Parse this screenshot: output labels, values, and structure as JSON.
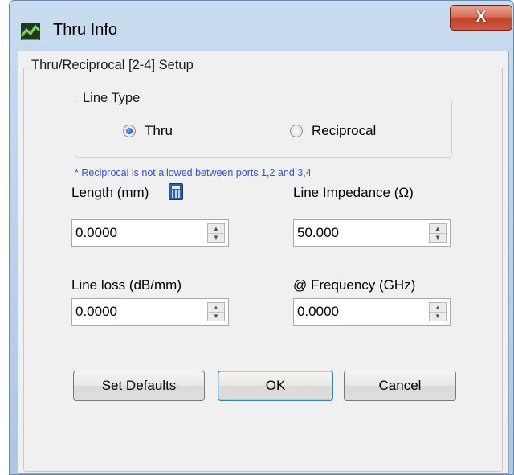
{
  "window": {
    "title": "Thru Info",
    "close_label": "X"
  },
  "setup_group": {
    "title": "Thru/Reciprocal [2-4] Setup"
  },
  "line_type": {
    "title": "Line Type",
    "options": [
      {
        "label": "Thru",
        "checked": true
      },
      {
        "label": "Reciprocal",
        "checked": false
      }
    ]
  },
  "note": "* Reciprocal is not allowed between ports 1,2 and 3,4",
  "fields": {
    "length": {
      "label": "Length (mm)",
      "value": "0.0000"
    },
    "line_impedance": {
      "label": "Line Impedance (Ω)",
      "value": "50.000"
    },
    "line_loss": {
      "label": "Line loss (dB/mm)",
      "value": "0.0000"
    },
    "frequency": {
      "label": "@ Frequency (GHz)",
      "value": "0.0000"
    }
  },
  "buttons": {
    "set_defaults": "Set Defaults",
    "ok": "OK",
    "cancel": "Cancel"
  },
  "icons": {
    "app": "thru-info-app-icon",
    "calculator": "calculator-icon",
    "spin_up": "spin-up-icon",
    "spin_down": "spin-down-icon"
  }
}
